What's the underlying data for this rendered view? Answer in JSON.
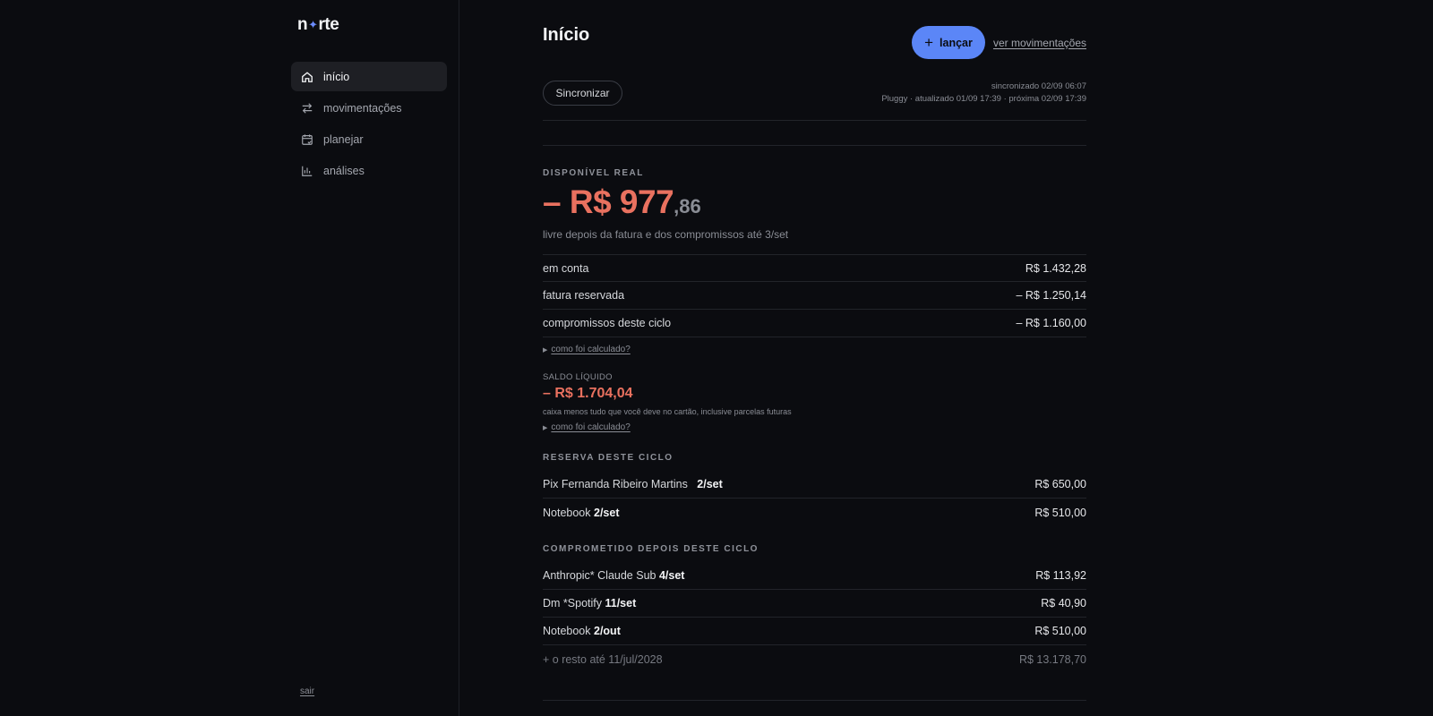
{
  "brand": {
    "logo_left": "n",
    "logo_star": "✦",
    "logo_right": "rte"
  },
  "sidebar": {
    "items": [
      {
        "label": "início",
        "icon": "home-icon",
        "active": true
      },
      {
        "label": "movimentações",
        "icon": "arrows-swap-icon",
        "active": false
      },
      {
        "label": "planejar",
        "icon": "calendar-icon",
        "active": false
      },
      {
        "label": "análises",
        "icon": "bar-chart-icon",
        "active": false
      }
    ],
    "logout": "sair"
  },
  "header": {
    "title": "Início",
    "launch_button": "lançar",
    "launch_icon": "plus-icon",
    "movements_link": "ver movimentações",
    "sync_button": "Sincronizar",
    "sync_line1": "sincronizado 02/09 06:07",
    "sync_line2": "Pluggy · atualizado 01/09 17:39 · próxima 02/09 17:39"
  },
  "available": {
    "kicker": "DISPONÍVEL REAL",
    "amount_main": "– R$ 977",
    "amount_cents": ",86",
    "caption": "livre depois da fatura e dos compromissos até 3/set",
    "rows": [
      {
        "label": "em conta",
        "value": "R$ 1.432,28"
      },
      {
        "label": "fatura reservada",
        "value": "– R$ 1.250,14"
      },
      {
        "label": "compromissos deste ciclo",
        "value": "– R$ 1.160,00"
      }
    ],
    "calc_link": "como foi calculado?"
  },
  "net_balance": {
    "kicker": "SALDO LÍQUIDO",
    "amount": "– R$ 1.704,04",
    "caption": "caixa menos tudo que você deve no cartão, inclusive parcelas futuras",
    "calc_link": "como foi calculado?"
  },
  "cycle_reserve": {
    "kicker": "RESERVA DESTE CICLO",
    "rows": [
      {
        "name": "Pix Fernanda Ribeiro Martins",
        "date": "2/set",
        "value": "R$ 650,00"
      },
      {
        "name": "Notebook",
        "date": "2/set",
        "value": "R$ 510,00"
      }
    ]
  },
  "committed_after": {
    "kicker": "COMPROMETIDO DEPOIS DESTE CICLO",
    "rows": [
      {
        "name": "Anthropic* Claude Sub",
        "date": "4/set",
        "value": "R$ 113,92"
      },
      {
        "name": "Dm *Spotify",
        "date": "11/set",
        "value": "R$ 40,90"
      },
      {
        "name": "Notebook",
        "date": "2/out",
        "value": "R$ 510,00"
      }
    ],
    "rest_label": "+ o resto até 11/jul/2028",
    "rest_value": "R$ 13.178,70"
  },
  "colors": {
    "accent": "#5b86f7",
    "negative": "#e9715f",
    "background": "#0b0c10"
  }
}
